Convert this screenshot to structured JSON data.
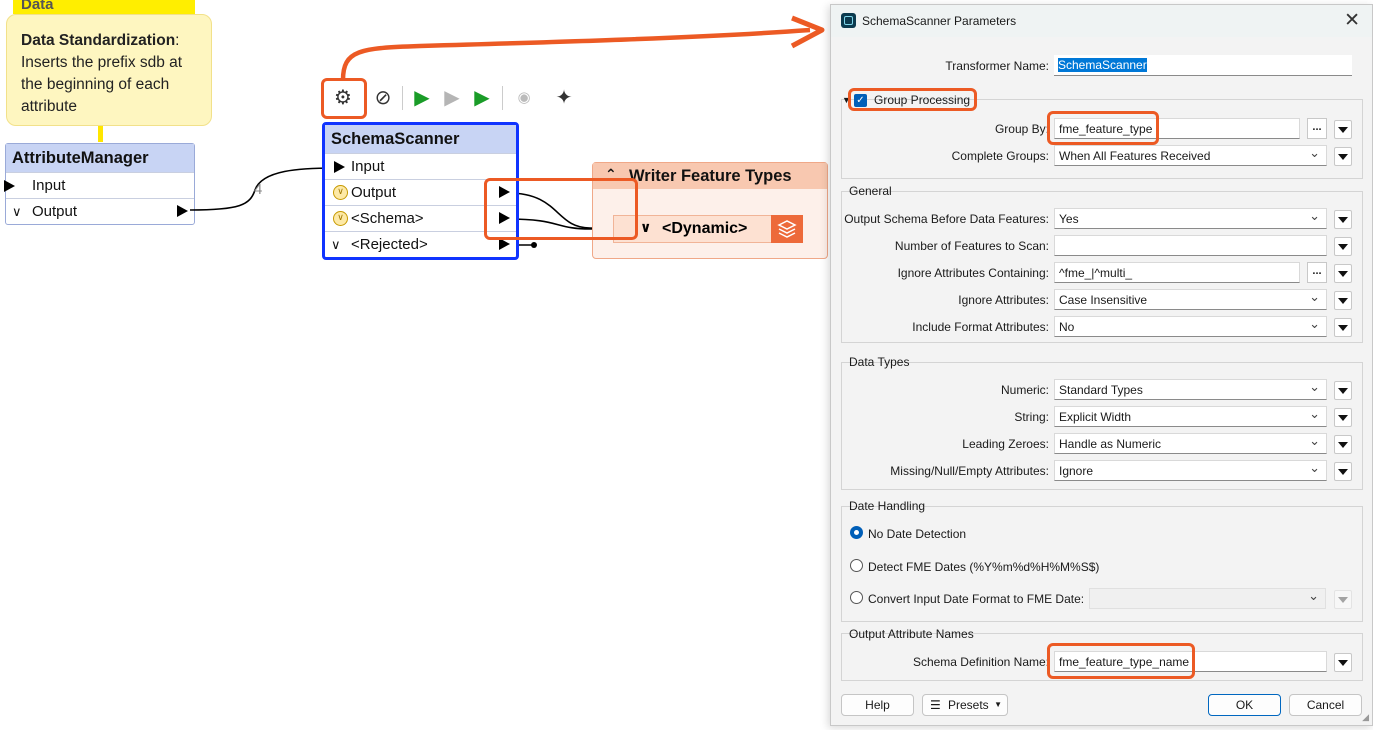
{
  "canvas": {
    "note": {
      "header_partial": "Data",
      "title": "Data Standardization",
      "body": "Inserts the prefix sdb at the beginning of each attribute"
    },
    "attribute_manager": {
      "title": "AttributeManager",
      "ports": [
        "Input",
        "Output"
      ]
    },
    "connection_count": "4",
    "schema_scanner": {
      "title": "SchemaScanner",
      "ports": [
        "Input",
        "Output",
        "<Schema>",
        "<Rejected>"
      ]
    },
    "writer": {
      "title": "Writer Feature Types",
      "feature_type": "<Dynamic>"
    },
    "toolbar": [
      "gear-icon",
      "disable-icon",
      "run-to-this-icon",
      "run-from-this-icon",
      "run-only-icon",
      "inspect-icon",
      "sparkle-icon"
    ]
  },
  "dialog": {
    "title": "SchemaScanner Parameters",
    "transformer_name_label": "Transformer Name:",
    "transformer_name_value": "SchemaScanner",
    "group_processing_label": "Group Processing",
    "group_by_label": "Group By:",
    "group_by_value": "fme_feature_type",
    "complete_groups_label": "Complete Groups:",
    "complete_groups_value": "When All Features Received",
    "general": {
      "label": "General",
      "output_schema_label": "Output Schema Before Data Features:",
      "output_schema_value": "Yes",
      "num_features_label": "Number of Features to Scan:",
      "num_features_value": "",
      "ignore_containing_label": "Ignore Attributes Containing:",
      "ignore_containing_value": "^fme_|^multi_",
      "ignore_attributes_label": "Ignore Attributes:",
      "ignore_attributes_value": "Case Insensitive",
      "include_format_label": "Include Format Attributes:",
      "include_format_value": "No"
    },
    "data_types": {
      "label": "Data Types",
      "numeric_label": "Numeric:",
      "numeric_value": "Standard Types",
      "string_label": "String:",
      "string_value": "Explicit Width",
      "leading_zeroes_label": "Leading Zeroes:",
      "leading_zeroes_value": "Handle as Numeric",
      "missing_label": "Missing/Null/Empty Attributes:",
      "missing_value": "Ignore"
    },
    "date_handling": {
      "label": "Date Handling",
      "opt1": "No Date Detection",
      "opt2": "Detect FME Dates (%Y%m%d%H%M%S$)",
      "opt3": "Convert Input Date Format to FME Date:"
    },
    "output_attrs": {
      "label": "Output Attribute Names",
      "schema_def_label": "Schema Definition Name:",
      "schema_def_value": "fme_feature_type_name"
    },
    "buttons": {
      "help": "Help",
      "presets": "Presets",
      "ok": "OK",
      "cancel": "Cancel"
    }
  },
  "colors": {
    "highlight": "#ec5a24",
    "accent": "#005fb8",
    "transformer_header": "#c8d4f4",
    "selected_border": "#1034ff"
  }
}
